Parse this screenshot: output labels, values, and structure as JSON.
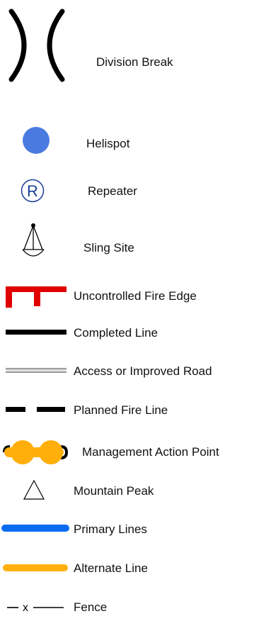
{
  "legend": {
    "items": [
      {
        "label": "Division Break",
        "icon": "division-break-icon"
      },
      {
        "label": "Helispot",
        "icon": "helispot-icon",
        "color": "#4a7ae0"
      },
      {
        "label": "Repeater",
        "icon": "repeater-icon",
        "symbol_letter": "R",
        "color": "#1a3f99"
      },
      {
        "label": "Sling Site",
        "icon": "sling-site-icon"
      },
      {
        "label": "Uncontrolled Fire Edge",
        "icon": "uncontrolled-fire-edge-icon",
        "color": "#e00000"
      },
      {
        "label": "Completed Line",
        "icon": "completed-line-icon",
        "color": "#000000"
      },
      {
        "label": "Access or Improved Road",
        "icon": "access-road-icon",
        "color": "#b8b8b8"
      },
      {
        "label": "Planned Fire Line",
        "icon": "planned-fire-line-icon",
        "color": "#000000"
      },
      {
        "label": "Management Action Point",
        "icon": "management-action-point-icon",
        "color": "#ffae0a"
      },
      {
        "label": "Mountain Peak",
        "icon": "mountain-peak-icon"
      },
      {
        "label": "Primary Lines",
        "icon": "primary-lines-icon",
        "color": "#0a6cf0"
      },
      {
        "label": "Alternate Line",
        "icon": "alternate-line-icon",
        "color": "#ffb010"
      },
      {
        "label": "Fence",
        "icon": "fence-icon",
        "symbol_text": "x"
      }
    ]
  }
}
